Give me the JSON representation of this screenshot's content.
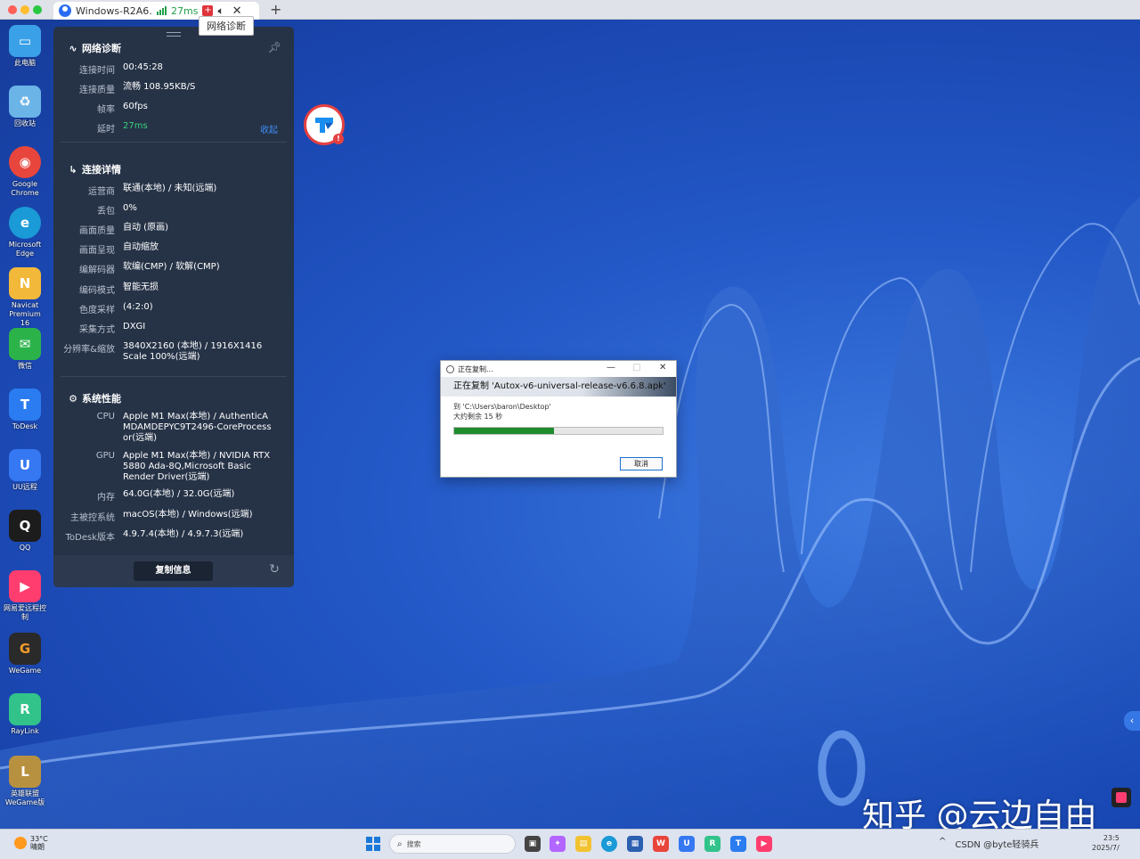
{
  "window": {
    "tab_title": "Windows-R2A6...",
    "latency": "27ms",
    "tooltip": "网络诊断",
    "new_tab": "+"
  },
  "desktop_icons": [
    {
      "label": "此电脑",
      "color": "#3aa0e8",
      "glyph": "▭"
    },
    {
      "label": "回收站",
      "color": "#6bb4e8",
      "glyph": "♻"
    },
    {
      "label": "Google Chrome",
      "color": "#e8453c",
      "glyph": "◉"
    },
    {
      "label": "Microsoft Edge",
      "color": "#1a9ad6",
      "glyph": "e"
    },
    {
      "label": "Navicat Premium 16",
      "color": "#f2b83a",
      "glyph": "N"
    },
    {
      "label": "微信",
      "color": "#2bb34a",
      "glyph": "✉"
    },
    {
      "label": "ToDesk",
      "color": "#2a7cf0",
      "glyph": "T"
    },
    {
      "label": "UU远程",
      "color": "#3578f2",
      "glyph": "U"
    },
    {
      "label": "QQ",
      "color": "#1c1c1c",
      "glyph": "Q"
    },
    {
      "label": "网易爱远程控制",
      "color": "#ff3d6e",
      "glyph": "▶"
    },
    {
      "label": "WeGame",
      "color": "#2a2a2a",
      "glyph": "G"
    },
    {
      "label": "RayLink",
      "color": "#32c38b",
      "glyph": "R"
    },
    {
      "label": "英雄联盟WeGame版",
      "color": "#b89140",
      "glyph": "L"
    }
  ],
  "diagnostics": {
    "network": {
      "title": "网络诊断",
      "rows": [
        {
          "key": "连接时间",
          "value": "00:45:28"
        },
        {
          "key": "连接质量",
          "value": "流畅 108.95KB/S"
        },
        {
          "key": "帧率",
          "value": "60fps"
        },
        {
          "key": "延时",
          "value": "27ms"
        }
      ],
      "collapse": "收起"
    },
    "details": {
      "title": "连接详情",
      "rows": [
        {
          "key": "运营商",
          "value": "联通(本地) / 未知(远端)"
        },
        {
          "key": "丢包",
          "value": "0%"
        },
        {
          "key": "画面质量",
          "value": "自动 (原画)"
        },
        {
          "key": "画面呈现",
          "value": "自动缩放"
        },
        {
          "key": "编解码器",
          "value": "软编(CMP) / 软解(CMP)"
        },
        {
          "key": "编码模式",
          "value": "智能无损"
        },
        {
          "key": "色度采样",
          "value": "(4:2:0)"
        },
        {
          "key": "采集方式",
          "value": "DXGI"
        },
        {
          "key": "分辨率&缩放",
          "value": "3840X2160 (本地) / 1916X1416 Scale 100%(远端)"
        }
      ]
    },
    "performance": {
      "title": "系统性能",
      "rows": [
        {
          "key": "CPU",
          "value": "Apple M1 Max(本地) / AuthenticAMDAMDEPYC9T2496-CoreProcessor(远端)"
        },
        {
          "key": "GPU",
          "value": "Apple M1 Max(本地) / NVIDIA RTX 5880 Ada-8Q,Microsoft Basic Render Driver(远端)"
        },
        {
          "key": "内存",
          "value": "64.0G(本地) / 32.0G(远端)"
        },
        {
          "key": "主被控系统",
          "value": "macOS(本地) / Windows(远端)"
        },
        {
          "key": "ToDesk版本",
          "value": "4.9.7.4(本地) / 4.9.7.3(远端)"
        }
      ]
    },
    "copy_button": "复制信息"
  },
  "copy_dialog": {
    "title": "正在复制...",
    "heading": "正在复制 'Autox-v6-universal-release-v6.6.8.apk'",
    "destination": "到 'C:\\Users\\baron\\Desktop'",
    "remaining": "大约剩余 15 秒",
    "progress": 0.48,
    "cancel": "取消",
    "progress_color": "#1f8c2e"
  },
  "watermark": "知乎 @云边自由",
  "taskbar": {
    "weather_temp": "33°C",
    "weather_desc": "晴朗",
    "search_placeholder": "搜索",
    "tray_text": "CSDN @byte轻骑兵",
    "clock_time": "23:5",
    "clock_date": "2025/7/"
  },
  "colors": {
    "accent": "#3d8ef5",
    "panel_bg": "#263347",
    "latency_green": "#3ad07a"
  }
}
